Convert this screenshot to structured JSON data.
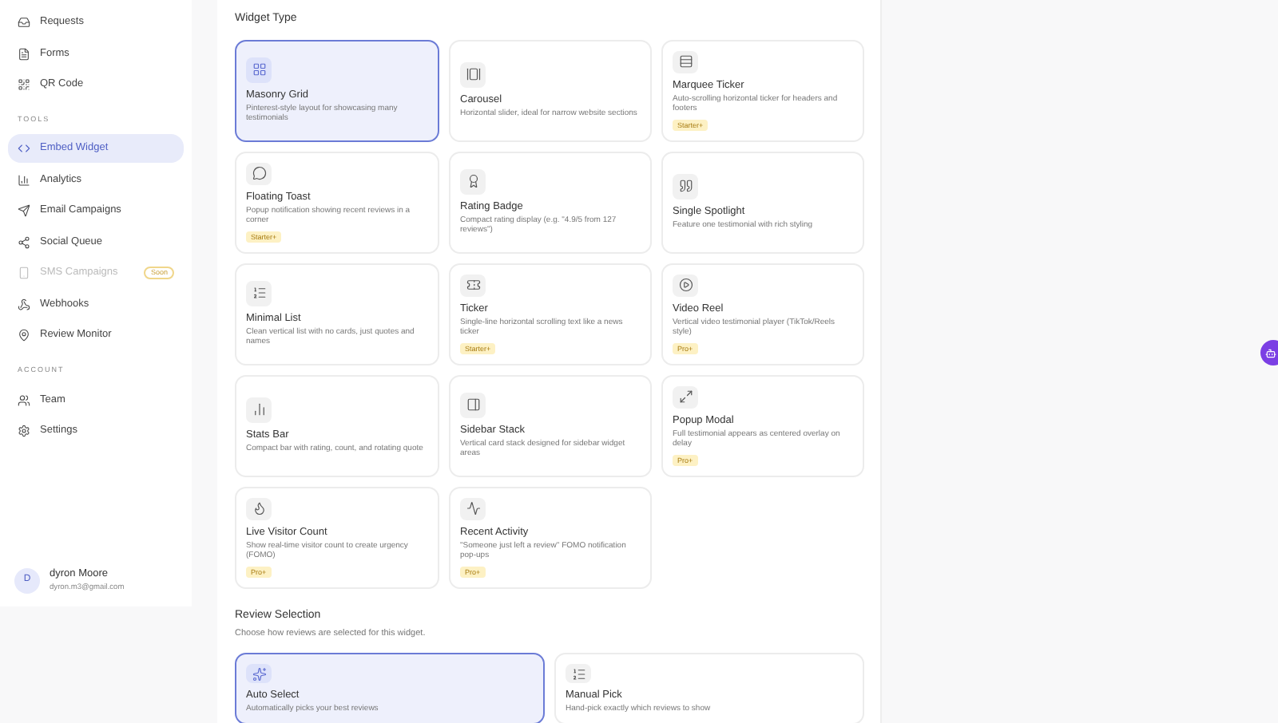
{
  "sidebar": {
    "groups": [
      {
        "items": [
          {
            "label": "Requests",
            "selected": false,
            "disabled": false
          },
          {
            "label": "Forms",
            "selected": false,
            "disabled": false
          },
          {
            "label": "QR Code",
            "selected": false,
            "disabled": false
          }
        ]
      },
      {
        "heading": "TOOLS",
        "items": [
          {
            "label": "Embed Widget",
            "selected": true,
            "disabled": false
          },
          {
            "label": "Analytics",
            "selected": false,
            "disabled": false
          },
          {
            "label": "Email Campaigns",
            "selected": false,
            "disabled": false
          },
          {
            "label": "Social Queue",
            "selected": false,
            "disabled": false
          },
          {
            "label": "SMS Campaigns",
            "selected": false,
            "disabled": true,
            "badge": "Soon"
          },
          {
            "label": "Webhooks",
            "selected": false,
            "disabled": false
          },
          {
            "label": "Review Monitor",
            "selected": false,
            "disabled": false
          }
        ]
      },
      {
        "heading": "ACCOUNT",
        "items": [
          {
            "label": "Team",
            "selected": false,
            "disabled": false
          },
          {
            "label": "Settings",
            "selected": false,
            "disabled": false
          }
        ]
      }
    ],
    "user": {
      "initial": "D",
      "name": "dyron Moore",
      "email": "dyron.m3@gmail.com"
    }
  },
  "widget_type": {
    "title": "Widget Type",
    "options": [
      {
        "title": "Masonry Grid",
        "description": "Pinterest-style layout for showcasing many testimonials",
        "selected": true
      },
      {
        "title": "Carousel",
        "description": "Horizontal slider, ideal for narrow website sections",
        "selected": false
      },
      {
        "title": "Marquee Ticker",
        "description": "Auto-scrolling horizontal ticker for headers and footers",
        "selected": false,
        "badge": "Starter+"
      },
      {
        "title": "Floating Toast",
        "description": "Popup notification showing recent reviews in a corner",
        "selected": false,
        "badge": "Starter+"
      },
      {
        "title": "Rating Badge",
        "description": "Compact rating display (e.g. \"4.9/5 from 127 reviews\")",
        "selected": false
      },
      {
        "title": "Single Spotlight",
        "description": "Feature one testimonial with rich styling",
        "selected": false
      },
      {
        "title": "Minimal List",
        "description": "Clean vertical list with no cards, just quotes and names",
        "selected": false
      },
      {
        "title": "Ticker",
        "description": "Single-line horizontal scrolling text like a news ticker",
        "selected": false,
        "badge": "Starter+"
      },
      {
        "title": "Video Reel",
        "description": "Vertical video testimonial player (TikTok/Reels style)",
        "selected": false,
        "badge": "Pro+"
      },
      {
        "title": "Stats Bar",
        "description": "Compact bar with rating, count, and rotating quote",
        "selected": false
      },
      {
        "title": "Sidebar Stack",
        "description": "Vertical card stack designed for sidebar widget areas",
        "selected": false
      },
      {
        "title": "Popup Modal",
        "description": "Full testimonial appears as centered overlay on delay",
        "selected": false,
        "badge": "Pro+"
      },
      {
        "title": "Live Visitor Count",
        "description": "Show real-time visitor count to create urgency (FOMO)",
        "selected": false,
        "badge": "Pro+"
      },
      {
        "title": "Recent Activity",
        "description": "\"Someone just left a review\" FOMO notification pop-ups",
        "selected": false,
        "badge": "Pro+"
      }
    ]
  },
  "review_selection": {
    "title": "Review Selection",
    "subtitle": "Choose how reviews are selected for this widget.",
    "options": [
      {
        "title": "Auto Select",
        "description": "Automatically picks your best reviews",
        "selected": true
      },
      {
        "title": "Manual Pick",
        "description": "Hand-pick exactly which reviews to show",
        "selected": false
      }
    ]
  }
}
